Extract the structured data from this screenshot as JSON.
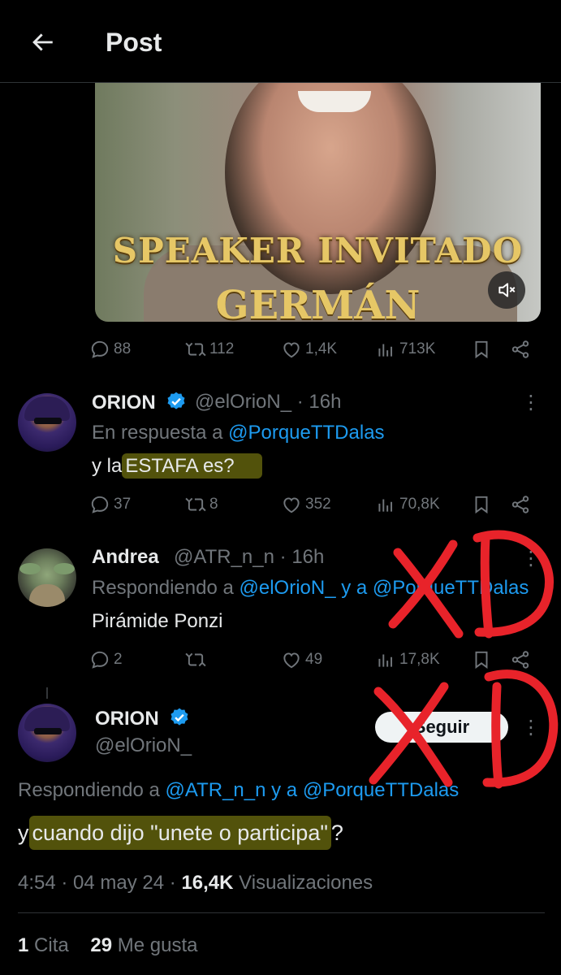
{
  "header": {
    "title": "Post",
    "back_icon": "arrow-left-icon"
  },
  "video": {
    "caption_line1": "SPEAKER INVITADO",
    "caption_line2": "GERMÁN",
    "mute_icon": "speaker-muted-icon"
  },
  "quoted_actions": {
    "replies": "88",
    "reposts": "112",
    "likes": "1,4K",
    "views": "713K"
  },
  "reply1": {
    "name": "ORION",
    "handle": "@elOrioN_",
    "time": "· 16h",
    "in_reply_prefix": "En respuesta a",
    "in_reply_user": "@PorqueTTDalas",
    "text_prefix": "y la",
    "text_highlight": "ESTAFA es?",
    "actions": {
      "replies": "37",
      "reposts": "8",
      "likes": "352",
      "views": "70,8K"
    }
  },
  "reply2": {
    "name": "Andrea",
    "handle": "@ATR_n_n",
    "time": "· 16h",
    "reply_prefix": "Respondiendo a",
    "reply_user1": "@elOrioN_",
    "reply_mid": "y a",
    "reply_user2": "@PorqueTTDalas",
    "text": "Pirámide Ponzi",
    "actions": {
      "replies": "2",
      "reposts": "",
      "likes": "49",
      "views": "17,8K"
    }
  },
  "main": {
    "name": "ORION",
    "handle": "@elOrioN_",
    "follow_label": "Seguir",
    "reply_prefix": "Respondiendo a",
    "reply_user1": "@ATR_n_n",
    "reply_mid": "y a",
    "reply_user2": "@PorqueTTDalas",
    "text_prefix": "y",
    "text_highlight": "cuando dijo \"unete o participa\"",
    "text_suffix": "?",
    "time": "4:54 · 04 may 24 ·",
    "views_count": "16,4K",
    "views_label": "Visualizaciones",
    "quotes_count": "1",
    "quotes_label": "Cita",
    "likes_count": "29",
    "likes_label": "Me gusta"
  },
  "colors": {
    "background": "#000000",
    "link": "#1d9bf0",
    "muted": "#71767b",
    "annotation": "#e8232a"
  }
}
